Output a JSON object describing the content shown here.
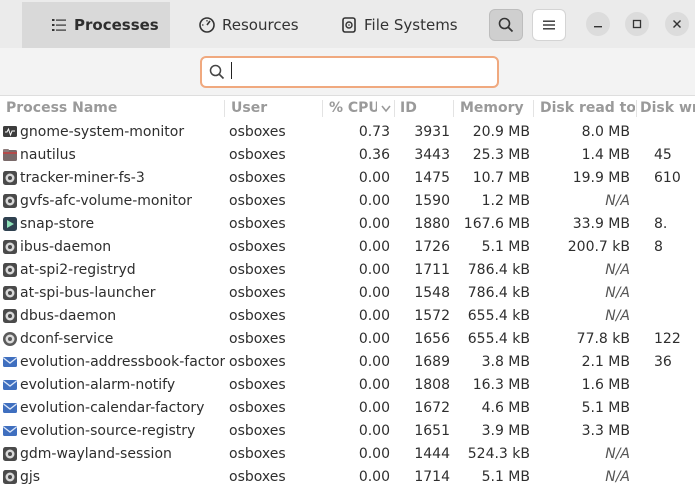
{
  "header": {
    "tabs": [
      {
        "label": "Processes",
        "icon": "list-icon",
        "active": true
      },
      {
        "label": "Resources",
        "icon": "gauge-icon",
        "active": false
      },
      {
        "label": "File Systems",
        "icon": "disk-icon",
        "active": false
      }
    ]
  },
  "search": {
    "value": "",
    "placeholder": ""
  },
  "columns": [
    "Process Name",
    "User",
    "% CPU",
    "ID",
    "Memory",
    "Disk read tota",
    "Disk wri"
  ],
  "sort": {
    "column": "% CPU",
    "direction": "descending"
  },
  "rows": [
    {
      "name": "gnome-system-monitor",
      "icon": "monitor-icon",
      "user": "osboxes",
      "cpu": "0.73",
      "id": "3931",
      "memory": "20.9 MB",
      "disk_read": "8.0 MB",
      "disk_write": ""
    },
    {
      "name": "nautilus",
      "icon": "folder-icon",
      "user": "osboxes",
      "cpu": "0.36",
      "id": "3443",
      "memory": "25.3 MB",
      "disk_read": "1.4 MB",
      "disk_write": "45"
    },
    {
      "name": "tracker-miner-fs-3",
      "icon": "gear-icon",
      "user": "osboxes",
      "cpu": "0.00",
      "id": "1475",
      "memory": "10.7 MB",
      "disk_read": "19.9 MB",
      "disk_write": "610"
    },
    {
      "name": "gvfs-afc-volume-monitor",
      "icon": "gear-icon",
      "user": "osboxes",
      "cpu": "0.00",
      "id": "1590",
      "memory": "1.2 MB",
      "disk_read": "N/A",
      "disk_write": ""
    },
    {
      "name": "snap-store",
      "icon": "snap-icon",
      "user": "osboxes",
      "cpu": "0.00",
      "id": "1880",
      "memory": "167.6 MB",
      "disk_read": "33.9 MB",
      "disk_write": "8."
    },
    {
      "name": "ibus-daemon",
      "icon": "gear-icon",
      "user": "osboxes",
      "cpu": "0.00",
      "id": "1726",
      "memory": "5.1 MB",
      "disk_read": "200.7 kB",
      "disk_write": "8"
    },
    {
      "name": "at-spi2-registryd",
      "icon": "gear-icon",
      "user": "osboxes",
      "cpu": "0.00",
      "id": "1711",
      "memory": "786.4 kB",
      "disk_read": "N/A",
      "disk_write": ""
    },
    {
      "name": "at-spi-bus-launcher",
      "icon": "gear-icon",
      "user": "osboxes",
      "cpu": "0.00",
      "id": "1548",
      "memory": "786.4 kB",
      "disk_read": "N/A",
      "disk_write": ""
    },
    {
      "name": "dbus-daemon",
      "icon": "gear-icon",
      "user": "osboxes",
      "cpu": "0.00",
      "id": "1572",
      "memory": "655.4 kB",
      "disk_read": "N/A",
      "disk_write": ""
    },
    {
      "name": "dconf-service",
      "icon": "dconf-icon",
      "user": "osboxes",
      "cpu": "0.00",
      "id": "1656",
      "memory": "655.4 kB",
      "disk_read": "77.8 kB",
      "disk_write": "122"
    },
    {
      "name": "evolution-addressbook-factory",
      "icon": "mail-icon",
      "user": "osboxes",
      "cpu": "0.00",
      "id": "1689",
      "memory": "3.8 MB",
      "disk_read": "2.1 MB",
      "disk_write": "36"
    },
    {
      "name": "evolution-alarm-notify",
      "icon": "mail-icon",
      "user": "osboxes",
      "cpu": "0.00",
      "id": "1808",
      "memory": "16.3 MB",
      "disk_read": "1.6 MB",
      "disk_write": ""
    },
    {
      "name": "evolution-calendar-factory",
      "icon": "mail-icon",
      "user": "osboxes",
      "cpu": "0.00",
      "id": "1672",
      "memory": "4.6 MB",
      "disk_read": "5.1 MB",
      "disk_write": ""
    },
    {
      "name": "evolution-source-registry",
      "icon": "mail-icon",
      "user": "osboxes",
      "cpu": "0.00",
      "id": "1651",
      "memory": "3.9 MB",
      "disk_read": "3.3 MB",
      "disk_write": ""
    },
    {
      "name": "gdm-wayland-session",
      "icon": "gear-icon",
      "user": "osboxes",
      "cpu": "0.00",
      "id": "1444",
      "memory": "524.3 kB",
      "disk_read": "N/A",
      "disk_write": ""
    },
    {
      "name": "gjs",
      "icon": "gear-icon",
      "user": "osboxes",
      "cpu": "0.00",
      "id": "1714",
      "memory": "5.1 MB",
      "disk_read": "N/A",
      "disk_write": ""
    }
  ],
  "colors": {
    "accent": "#e95420",
    "focus_border": "#f0a97f",
    "header_bg": "#ebebeb",
    "active_tab": "#d9d9d9"
  }
}
